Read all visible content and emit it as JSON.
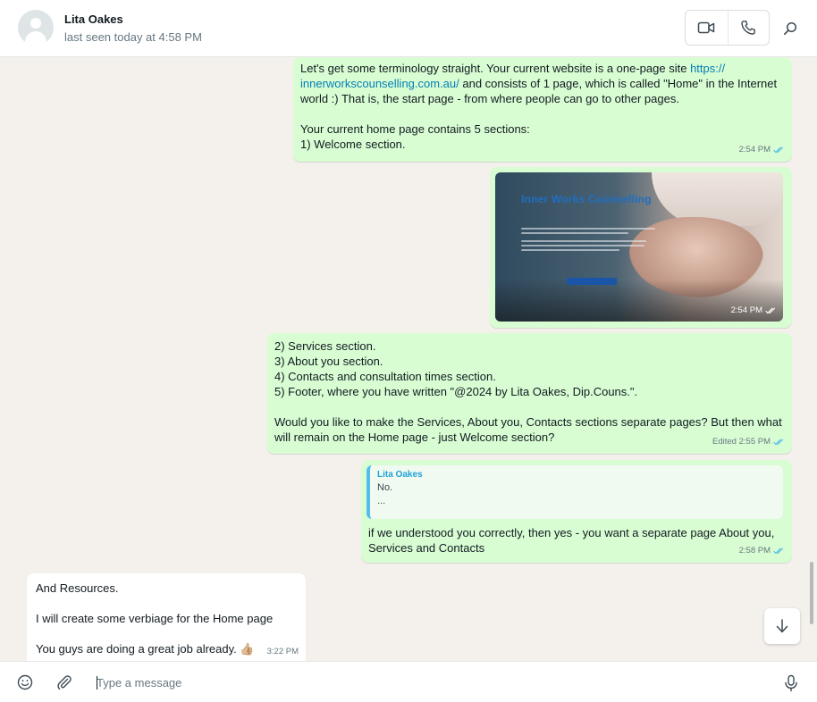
{
  "header": {
    "contact_name": "Lita Oakes",
    "last_seen": "last seen today at 4:58 PM",
    "icons": [
      "avatar-placeholder-icon",
      "video-call-icon",
      "voice-call-icon",
      "search-icon"
    ]
  },
  "messages": [
    {
      "direction": "outgoing",
      "text_before_link": "Let's get some terminology straight. Your current website is a one-page site ",
      "link_line1": "https://",
      "link_line2": "innerworkscounselling.com.au/",
      "text_after_link": " and consists of 1 page, which is called \"Home\" in the Internet\nworld :) That is, the start page - from where people can go to other pages.\n\nYour current home page contains 5 sections:\n1) Welcome section.",
      "time": "2:54 PM",
      "status": "read"
    },
    {
      "direction": "outgoing",
      "type": "image",
      "image_title": "Inner Works Counselling",
      "time": "2:54 PM",
      "status": "read"
    },
    {
      "direction": "outgoing",
      "text": "2) Services section.\n3) About you section.\n4) Contacts and consultation times section.\n5) Footer, where you have written \"@2024 by Lita Oakes, Dip.Couns.\".\n\nWould you like to make the Services, About you, Contacts sections separate pages? But then what\nwill remain on the Home page - just Welcome section?",
      "time": "Edited 2:55 PM",
      "status": "read"
    },
    {
      "direction": "outgoing",
      "quote_author": "Lita Oakes",
      "quote_text": "No.\n...",
      "text": "if we understood you correctly, then yes - you want a separate page About you,\nServices and Contacts",
      "time": "2:58 PM",
      "status": "read"
    },
    {
      "direction": "incoming",
      "text": "And Resources.\n\nI will create some verbiage for the Home page\n\nYou guys are doing a great job already. 👍🏼",
      "time": "3:22 PM"
    }
  ],
  "composer": {
    "placeholder": "Type a message",
    "icons": [
      "emoji-icon",
      "attachment-icon",
      "microphone-icon"
    ]
  },
  "colors": {
    "outgoing_bubble": "#d9fdd3",
    "incoming_bubble": "#ffffff",
    "chat_background": "#f4f1ec",
    "link": "#027eb5",
    "read_ticks": "#53bdeb"
  }
}
